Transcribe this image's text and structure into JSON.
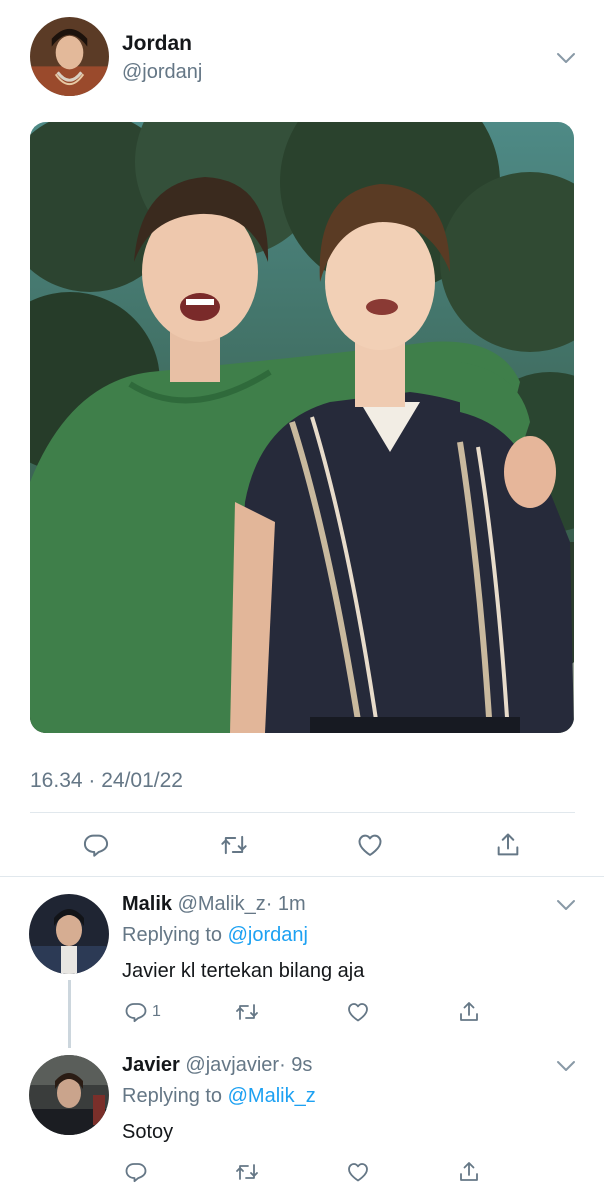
{
  "tweet": {
    "author_name": "Jordan",
    "author_handle": "@jordanj",
    "timestamp": "16.34 · 24/01/22",
    "image_alt": "two-friends-photo"
  },
  "replies": [
    {
      "name": "Malik",
      "handle": "@Malik_z",
      "time": "· 1m",
      "replying_label": "Replying to",
      "replying_to": "@jordanj",
      "text": "Javier kl tertekan bilang aja",
      "reply_count": "1"
    },
    {
      "name": "Javier",
      "handle": "@javjavier",
      "time": "· 9s",
      "replying_label": "Replying to",
      "replying_to": "@Malik_z",
      "text": "Sotoy",
      "reply_count": ""
    }
  ],
  "colors": {
    "accent": "#1da1f2",
    "secondary_text": "#657786",
    "divider": "#e1e8ed"
  },
  "icons": [
    "reply-icon",
    "retweet-icon",
    "like-icon",
    "share-icon",
    "chevron-down-icon"
  ]
}
